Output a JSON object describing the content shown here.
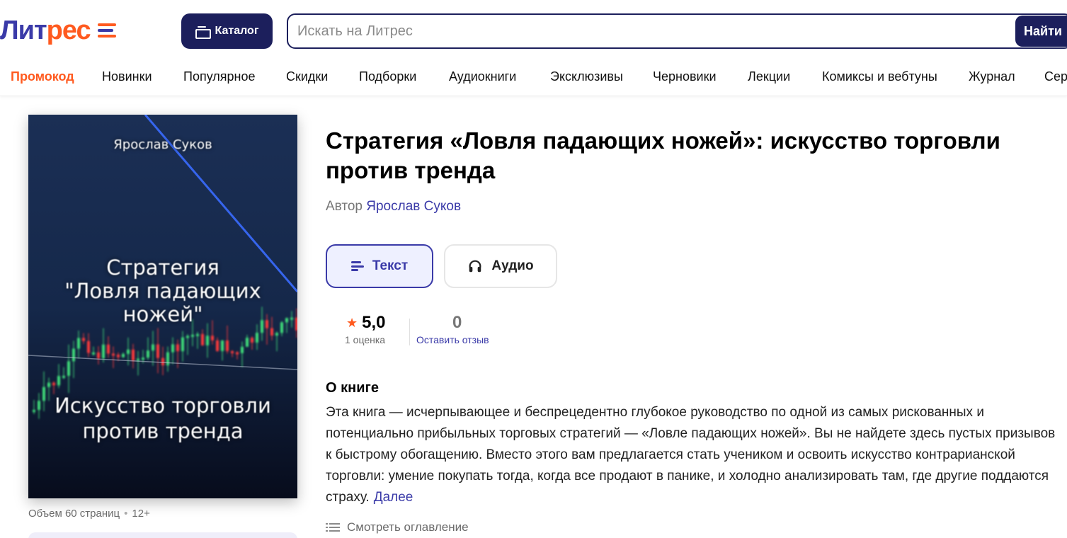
{
  "header": {
    "logo_part1": "Лит",
    "logo_part2": "рес",
    "catalog_label": "Каталог",
    "search_placeholder": "Искать на Литрес",
    "search_button": "Найти"
  },
  "nav": {
    "items": [
      {
        "label": "Промокод",
        "active": true
      },
      {
        "label": "Новинки"
      },
      {
        "label": "Популярное"
      },
      {
        "label": "Скидки"
      },
      {
        "label": "Подборки"
      },
      {
        "label": "Аудиокниги"
      },
      {
        "label": "Эксклюзивы"
      },
      {
        "label": "Черновики"
      },
      {
        "label": "Лекции"
      },
      {
        "label": "Комиксы и вебтуны"
      },
      {
        "label": "Журнал"
      },
      {
        "label": "Сер"
      }
    ]
  },
  "cover": {
    "author": "Ярослав Суков",
    "title_line1": "Стратегия",
    "title_line2": "\"Ловля падающих",
    "title_line3": "ножей\"",
    "subtitle_line1": "Искусство торговли",
    "subtitle_line2": "против тренда"
  },
  "book": {
    "title": "Стратегия «Ловля падающих ножей»: искусство торговли против тренда",
    "author_prefix": "Автор",
    "author_name": "Ярослав Суков",
    "pages": "Объем 60 страниц",
    "age": "12+"
  },
  "formats": {
    "text_label": "Текст",
    "audio_label": "Аудио"
  },
  "rating": {
    "value": "5,0",
    "count_label": "1 оценка",
    "reviews_count": "0",
    "reviews_link": "Оставить отзыв"
  },
  "about": {
    "heading": "О книге",
    "text": "Эта книга — исчерпывающее и беспрецедентно глубокое руководство по одной из самых рискованных и потенциально прибыльных торговых стратегий — «Ловле падающих ножей». Вы не найдете здесь пустых призывов к быстрому обогащению. Вместо этого вам предлагается стать учеником и освоить искусство контрарианской торговли: умение покупать тогда, когда все продают в панике, и холодно анализировать там, где другие поддаются страху.",
    "more_link": "Далее",
    "toc_link": "Смотреть оглавление"
  },
  "colors": {
    "brand_dark": "#1c1f5c",
    "brand_blue": "#3a3aa8",
    "accent_orange": "#ff5a1f"
  }
}
